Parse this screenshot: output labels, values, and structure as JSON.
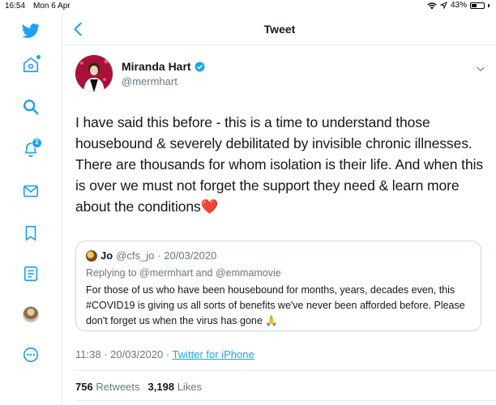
{
  "status": {
    "time": "16:54",
    "date": "Mon 6 Apr",
    "battery_text": "43%",
    "battery_level": 0.43
  },
  "sidebar": {
    "notifications_badge": "2"
  },
  "header": {
    "title": "Tweet"
  },
  "tweet": {
    "author_name": "Miranda Hart",
    "author_handle": "@mermhart",
    "text": "I have said this before - this is a time to understand those housebound & severely debilitated by invisible chronic illnesses. There are thousands for whom isolation is their life. And when this is over we must not forget the support they need & learn more about the conditions",
    "text_emoji": "❤️",
    "time": "11:38 · 20/03/2020 · ",
    "client": "Twitter for iPhone",
    "retweets_count": "756",
    "retweets_label": "Retweets",
    "likes_count": "3,198",
    "likes_label": "Likes"
  },
  "quote": {
    "author_name": "Jo",
    "author_handle": "@cfs_jo",
    "date": "· 20/03/2020",
    "replying_to": "Replying to @mermhart and @emmamovie",
    "text": "For those of us who have been housebound for months, years, decades even, this #COVID19 is giving us all sorts of benefits we've never been afforded before. Please don't forget us when the virus has gone 🙏"
  },
  "colors": {
    "brand": "#1da1f2",
    "text": "#14171a",
    "muted": "#657786",
    "border": "#e6ecf0"
  }
}
